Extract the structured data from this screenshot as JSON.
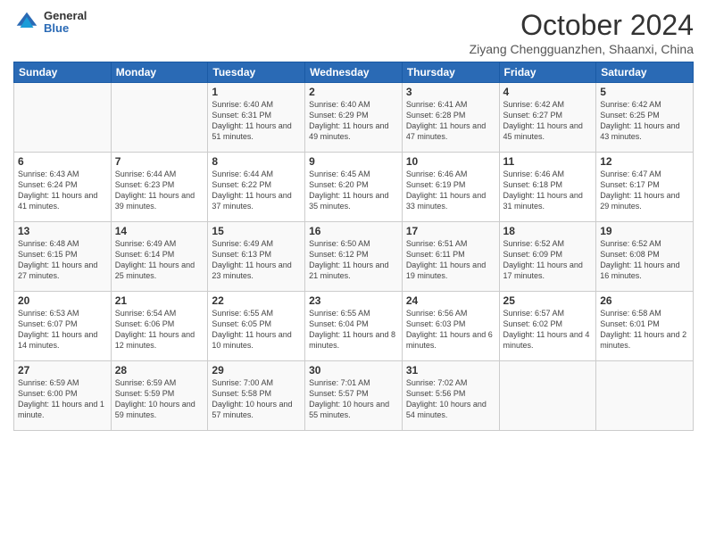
{
  "header": {
    "logo_general": "General",
    "logo_blue": "Blue",
    "month": "October 2024",
    "location": "Ziyang Chengguanzhen, Shaanxi, China"
  },
  "weekdays": [
    "Sunday",
    "Monday",
    "Tuesday",
    "Wednesday",
    "Thursday",
    "Friday",
    "Saturday"
  ],
  "weeks": [
    [
      null,
      null,
      {
        "day": 1,
        "sunrise": "6:40 AM",
        "sunset": "6:31 PM",
        "daylight": "11 hours and 51 minutes."
      },
      {
        "day": 2,
        "sunrise": "6:40 AM",
        "sunset": "6:29 PM",
        "daylight": "11 hours and 49 minutes."
      },
      {
        "day": 3,
        "sunrise": "6:41 AM",
        "sunset": "6:28 PM",
        "daylight": "11 hours and 47 minutes."
      },
      {
        "day": 4,
        "sunrise": "6:42 AM",
        "sunset": "6:27 PM",
        "daylight": "11 hours and 45 minutes."
      },
      {
        "day": 5,
        "sunrise": "6:42 AM",
        "sunset": "6:25 PM",
        "daylight": "11 hours and 43 minutes."
      }
    ],
    [
      {
        "day": 6,
        "sunrise": "6:43 AM",
        "sunset": "6:24 PM",
        "daylight": "11 hours and 41 minutes."
      },
      {
        "day": 7,
        "sunrise": "6:44 AM",
        "sunset": "6:23 PM",
        "daylight": "11 hours and 39 minutes."
      },
      {
        "day": 8,
        "sunrise": "6:44 AM",
        "sunset": "6:22 PM",
        "daylight": "11 hours and 37 minutes."
      },
      {
        "day": 9,
        "sunrise": "6:45 AM",
        "sunset": "6:20 PM",
        "daylight": "11 hours and 35 minutes."
      },
      {
        "day": 10,
        "sunrise": "6:46 AM",
        "sunset": "6:19 PM",
        "daylight": "11 hours and 33 minutes."
      },
      {
        "day": 11,
        "sunrise": "6:46 AM",
        "sunset": "6:18 PM",
        "daylight": "11 hours and 31 minutes."
      },
      {
        "day": 12,
        "sunrise": "6:47 AM",
        "sunset": "6:17 PM",
        "daylight": "11 hours and 29 minutes."
      }
    ],
    [
      {
        "day": 13,
        "sunrise": "6:48 AM",
        "sunset": "6:15 PM",
        "daylight": "11 hours and 27 minutes."
      },
      {
        "day": 14,
        "sunrise": "6:49 AM",
        "sunset": "6:14 PM",
        "daylight": "11 hours and 25 minutes."
      },
      {
        "day": 15,
        "sunrise": "6:49 AM",
        "sunset": "6:13 PM",
        "daylight": "11 hours and 23 minutes."
      },
      {
        "day": 16,
        "sunrise": "6:50 AM",
        "sunset": "6:12 PM",
        "daylight": "11 hours and 21 minutes."
      },
      {
        "day": 17,
        "sunrise": "6:51 AM",
        "sunset": "6:11 PM",
        "daylight": "11 hours and 19 minutes."
      },
      {
        "day": 18,
        "sunrise": "6:52 AM",
        "sunset": "6:09 PM",
        "daylight": "11 hours and 17 minutes."
      },
      {
        "day": 19,
        "sunrise": "6:52 AM",
        "sunset": "6:08 PM",
        "daylight": "11 hours and 16 minutes."
      }
    ],
    [
      {
        "day": 20,
        "sunrise": "6:53 AM",
        "sunset": "6:07 PM",
        "daylight": "11 hours and 14 minutes."
      },
      {
        "day": 21,
        "sunrise": "6:54 AM",
        "sunset": "6:06 PM",
        "daylight": "11 hours and 12 minutes."
      },
      {
        "day": 22,
        "sunrise": "6:55 AM",
        "sunset": "6:05 PM",
        "daylight": "11 hours and 10 minutes."
      },
      {
        "day": 23,
        "sunrise": "6:55 AM",
        "sunset": "6:04 PM",
        "daylight": "11 hours and 8 minutes."
      },
      {
        "day": 24,
        "sunrise": "6:56 AM",
        "sunset": "6:03 PM",
        "daylight": "11 hours and 6 minutes."
      },
      {
        "day": 25,
        "sunrise": "6:57 AM",
        "sunset": "6:02 PM",
        "daylight": "11 hours and 4 minutes."
      },
      {
        "day": 26,
        "sunrise": "6:58 AM",
        "sunset": "6:01 PM",
        "daylight": "11 hours and 2 minutes."
      }
    ],
    [
      {
        "day": 27,
        "sunrise": "6:59 AM",
        "sunset": "6:00 PM",
        "daylight": "11 hours and 1 minute."
      },
      {
        "day": 28,
        "sunrise": "6:59 AM",
        "sunset": "5:59 PM",
        "daylight": "10 hours and 59 minutes."
      },
      {
        "day": 29,
        "sunrise": "7:00 AM",
        "sunset": "5:58 PM",
        "daylight": "10 hours and 57 minutes."
      },
      {
        "day": 30,
        "sunrise": "7:01 AM",
        "sunset": "5:57 PM",
        "daylight": "10 hours and 55 minutes."
      },
      {
        "day": 31,
        "sunrise": "7:02 AM",
        "sunset": "5:56 PM",
        "daylight": "10 hours and 54 minutes."
      },
      null,
      null
    ]
  ]
}
